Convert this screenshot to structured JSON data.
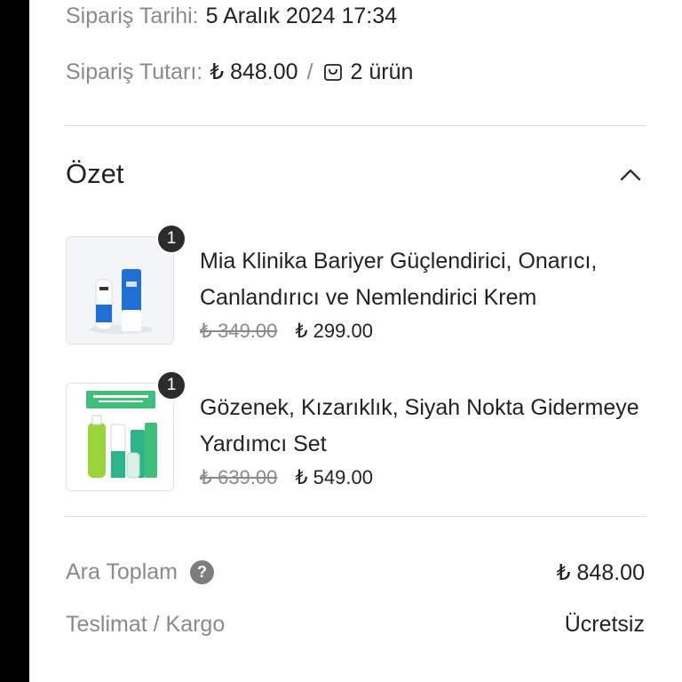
{
  "order": {
    "date_label": "Sipariş Tarihi:",
    "date_value": "5 Aralık 2024 17:34",
    "amount_label": "Sipariş Tutarı:",
    "amount_value": "₺ 848.00",
    "separator": "/",
    "items_count": "2 ürün",
    "bag_icon": "shopping-bag-icon"
  },
  "summary": {
    "title": "Özet",
    "toggle_icon": "chevron-up-icon",
    "items": [
      {
        "quantity": "1",
        "name": "Mia Klinika Bariyer Güçlendirici, Onarıcı, Canlandırıcı ve Nemlendirici Krem",
        "old_price": "₺ 349.00",
        "price": "₺ 299.00"
      },
      {
        "quantity": "1",
        "name": "Gözenek, Kızarıklık, Siyah Nokta Gidermeye Yardımcı Set",
        "old_price": "₺ 639.00",
        "price": "₺ 549.00"
      }
    ]
  },
  "totals": {
    "subtotal_label": "Ara Toplam",
    "subtotal_help": "?",
    "subtotal_value": "₺ 848.00",
    "shipping_label": "Teslimat / Kargo",
    "shipping_value": "Ücretsiz"
  },
  "colors": {
    "text": "#222222",
    "muted": "#8a8a8a",
    "badge": "#2b2b2b",
    "product_blue": "#1f6fd6",
    "product_green": "#3fbf7a"
  }
}
